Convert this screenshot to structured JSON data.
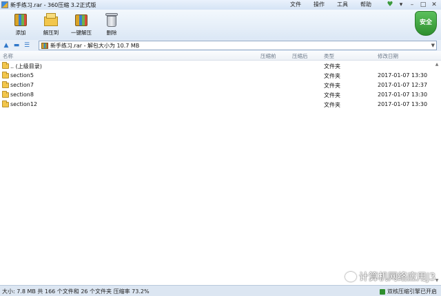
{
  "window": {
    "title": "新手练习.rar - 360压缩 3.2正式版"
  },
  "menu": [
    "文件",
    "操作",
    "工具",
    "帮助"
  ],
  "toolbar": {
    "add": "添加",
    "extract_to": "解压到",
    "one_click_extract": "一键解压",
    "delete": "删除"
  },
  "security_badge": "安全",
  "address": {
    "path": "新手练习.rar - 解包大小为 10.7 MB"
  },
  "columns": {
    "name": "名称",
    "compressed": "压缩前",
    "packed": "压缩后",
    "type": "类型",
    "modified": "修改日期"
  },
  "files": [
    {
      "name": ".. (上级目录)",
      "type": "文件夹",
      "modified": ""
    },
    {
      "name": "section5",
      "type": "文件夹",
      "modified": "2017-01-07 13:30"
    },
    {
      "name": "section7",
      "type": "文件夹",
      "modified": "2017-01-07 12:37"
    },
    {
      "name": "section8",
      "type": "文件夹",
      "modified": "2017-01-07 13:30"
    },
    {
      "name": "section12",
      "type": "文件夹",
      "modified": "2017-01-07 13:30"
    }
  ],
  "status": {
    "summary": "大小: 7.8 MB 共 166 个文件和 26 个文件夹 压缩率 73.2%",
    "engine": "双核压缩引擎已开启"
  },
  "watermark": "计算机网络应用J3"
}
